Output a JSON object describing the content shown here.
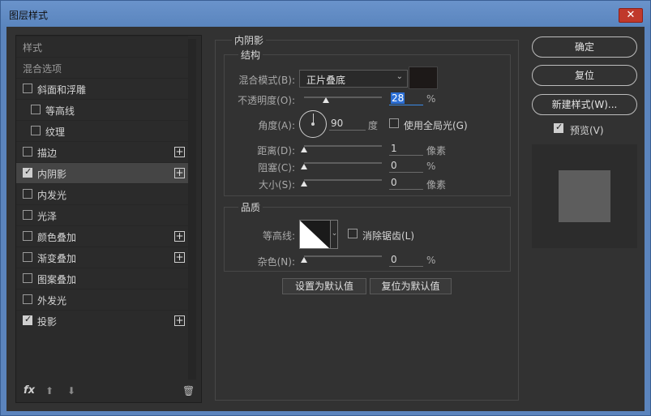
{
  "window": {
    "title": "图层样式",
    "close_label": "✕"
  },
  "left": {
    "items": [
      {
        "label": "样式",
        "checkbox": false,
        "checked": false,
        "plus": false,
        "dim": true
      },
      {
        "label": "混合选项",
        "checkbox": false,
        "checked": false,
        "plus": false,
        "dim": true
      },
      {
        "label": "斜面和浮雕",
        "checkbox": true,
        "checked": false,
        "plus": false
      },
      {
        "label": "等高线",
        "checkbox": true,
        "checked": false,
        "plus": false,
        "indent": true
      },
      {
        "label": "纹理",
        "checkbox": true,
        "checked": false,
        "plus": false,
        "indent": true
      },
      {
        "label": "描边",
        "checkbox": true,
        "checked": false,
        "plus": true
      },
      {
        "label": "内阴影",
        "checkbox": true,
        "checked": true,
        "plus": true,
        "selected": true
      },
      {
        "label": "内发光",
        "checkbox": true,
        "checked": false,
        "plus": false
      },
      {
        "label": "光泽",
        "checkbox": true,
        "checked": false,
        "plus": false
      },
      {
        "label": "颜色叠加",
        "checkbox": true,
        "checked": false,
        "plus": true
      },
      {
        "label": "渐变叠加",
        "checkbox": true,
        "checked": false,
        "plus": true
      },
      {
        "label": "图案叠加",
        "checkbox": true,
        "checked": false,
        "plus": false
      },
      {
        "label": "外发光",
        "checkbox": true,
        "checked": false,
        "plus": false
      },
      {
        "label": "投影",
        "checkbox": true,
        "checked": true,
        "plus": true
      }
    ],
    "footer": {
      "fx": "fx",
      "up": "⬆",
      "down": "⬇",
      "trash": "🗑"
    }
  },
  "inner_shadow": {
    "title": "内阴影",
    "structure": {
      "title": "结构",
      "blend_mode_label": "混合模式(B):",
      "blend_mode_value": "正片叠底",
      "blend_color": "#1d1918",
      "opacity_label": "不透明度(O):",
      "opacity_value": "28",
      "opacity_unit": "%",
      "opacity_level": 0.28,
      "angle_label": "角度(A):",
      "angle_value": "90",
      "angle_unit": "度",
      "global_light_label": "使用全局光(G)",
      "global_light_checked": false,
      "distance_label": "距离(D):",
      "distance_value": "1",
      "distance_unit": "像素",
      "choke_label": "阻塞(C):",
      "choke_value": "0",
      "choke_unit": "%",
      "size_label": "大小(S):",
      "size_value": "0",
      "size_unit": "像素"
    },
    "quality": {
      "title": "品质",
      "contour_label": "等高线:",
      "anti_alias_label": "消除锯齿(L)",
      "anti_alias_checked": false,
      "noise_label": "杂色(N):",
      "noise_value": "0",
      "noise_unit": "%"
    },
    "make_default": "设置为默认值",
    "reset_default": "复位为默认值"
  },
  "right": {
    "ok": "确定",
    "reset": "复位",
    "new_style": "新建样式(W)...",
    "preview_label": "预览(V)",
    "preview_checked": true
  }
}
